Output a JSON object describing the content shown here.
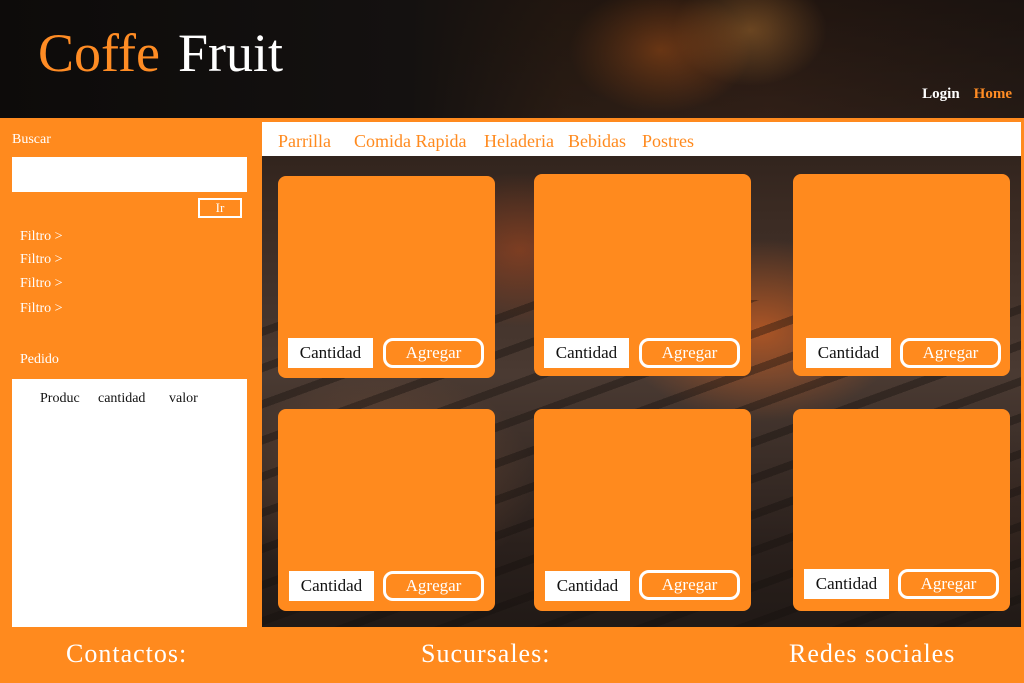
{
  "brand": {
    "word1": "Coffe",
    "word2": "Fruit"
  },
  "top_nav": {
    "login": "Login",
    "home": "Home"
  },
  "sidebar": {
    "search_label": "Buscar",
    "search_value": "",
    "search_button": "Ir",
    "filters": [
      "Filtro >",
      "Filtro >",
      "Filtro >",
      "Filtro >"
    ],
    "order_label": "Pedido",
    "order_columns": [
      "Produc",
      "cantidad",
      "valor"
    ]
  },
  "categories": [
    "Parrilla",
    "Comida Rapida",
    "Heladeria",
    "Bebidas",
    "Postres"
  ],
  "products": [
    {
      "quantity_label": "Cantidad",
      "add_label": "Agregar"
    },
    {
      "quantity_label": "Cantidad",
      "add_label": "Agregar"
    },
    {
      "quantity_label": "Cantidad",
      "add_label": "Agregar"
    },
    {
      "quantity_label": "Cantidad",
      "add_label": "Agregar"
    },
    {
      "quantity_label": "Cantidad",
      "add_label": "Agregar"
    },
    {
      "quantity_label": "Cantidad",
      "add_label": "Agregar"
    }
  ],
  "footer": {
    "contacts": "Contactos:",
    "branches": "Sucursales:",
    "social": "Redes sociales"
  },
  "colors": {
    "accent": "#ff8a1e",
    "text_light": "#ffffff",
    "panel": "#ffffff"
  }
}
